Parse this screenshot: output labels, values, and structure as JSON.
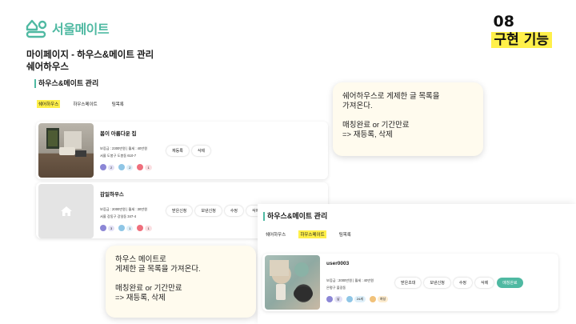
{
  "logo": {
    "text": "서울메이트"
  },
  "badge": {
    "number": "08",
    "title": "구현 기능"
  },
  "page_heading": {
    "line1": "마이페이지 - 하우스&메이트 관리",
    "line2": "쉐어하우스"
  },
  "section_a": {
    "title": "하우스&메이트 관리",
    "tabs": [
      "쉐어하우스",
      "하우스메이트",
      "팀목록"
    ],
    "active_tab": 0,
    "cards": [
      {
        "name": "봄이 아름다운 집",
        "info1": "보증금 : 2300만원 | 월세 : 40만원",
        "info2": "서울 도봉구 도봉동 610-7",
        "chips": [
          "2",
          "2",
          "1"
        ],
        "buttons": [
          "재등록",
          "삭제"
        ]
      },
      {
        "name": "감일하우스",
        "info1": "보증금 : 2000만원 | 월세 : 30만원",
        "info2": "서울 강동구 강일동 347-4",
        "chips": [
          "3",
          "1",
          "1"
        ],
        "buttons": [
          "받은신청",
          "보낸신청",
          "수정",
          "삭제"
        ]
      }
    ]
  },
  "section_b": {
    "title": "하우스&메이트 관리",
    "tabs": [
      "쉐어하우스",
      "하우스메이트",
      "팀목록"
    ],
    "active_tab": 1,
    "card": {
      "name": "user0003",
      "info1": "보증금 : 2000만원 | 월세 : 40만원",
      "info2": "은평구 불광동",
      "chips": [
        "남",
        "24세",
        "여성"
      ],
      "buttons": [
        "받은초대",
        "보낸신청",
        "수정",
        "삭제"
      ],
      "status_button": "매칭완료"
    }
  },
  "callouts": {
    "first": "쉐어하우스로 게제한 글 목록을\n가져온다.\n\n매칭완료 or 기간만료\n => 재등록, 삭제",
    "second": "하우스 메이트로\n게제한 글 목록을 가져온다.\n\n매칭완료 or 기간만료\n => 재등록, 삭제"
  },
  "colors": {
    "accent": "#4fb9a2",
    "highlight": "#fff04a",
    "callout_bg": "#fffbee"
  },
  "icons": [
    "logo-house-icon",
    "home-icon",
    "bed-icon",
    "bath-icon",
    "location-pin-icon"
  ]
}
